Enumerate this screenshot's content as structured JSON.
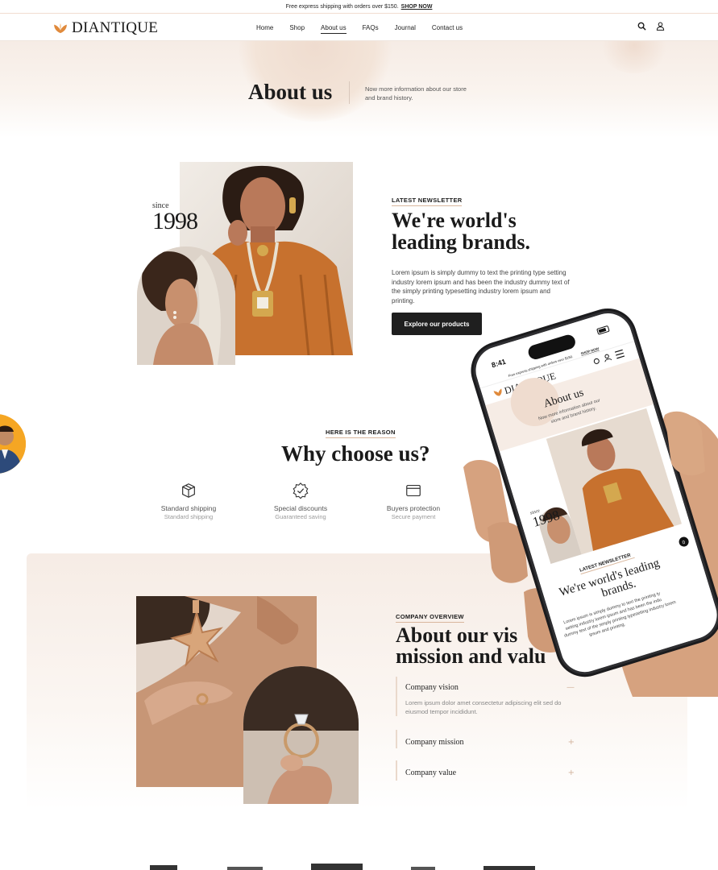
{
  "topbar": {
    "message": "Free express shipping with orders over $150.",
    "cta": "SHOP NOW"
  },
  "header": {
    "brand": "DIANTIQUE",
    "nav": [
      "Home",
      "Shop",
      "About us",
      "FAQs",
      "Journal",
      "Contact us"
    ],
    "active_nav": "About us",
    "icons": [
      "search-icon",
      "user-icon"
    ]
  },
  "hero": {
    "title": "About us",
    "description": "Now more information about our store and brand history."
  },
  "newsletter": {
    "since_label": "since",
    "since_year": "1998",
    "kicker": "LATEST NEWSLETTER",
    "title": "We're world's leading brands.",
    "body": "Lorem ipsum is simply dummy to text the printing type setting industry lorem ipsum and has been the industry dummy text of the simply printing typesetting industry lorem ipsum and printing.",
    "button": "Explore our products"
  },
  "why": {
    "kicker": "HERE IS THE REASON",
    "title": "Why choose us?",
    "features": [
      {
        "icon": "box-icon",
        "title": "Standard shipping",
        "sub": "Standard shipping"
      },
      {
        "icon": "badge-check-icon",
        "title": "Special discounts",
        "sub": "Guaranteed saving"
      },
      {
        "icon": "card-icon",
        "title": "Buyers protection",
        "sub": "Secure payment"
      }
    ]
  },
  "overview": {
    "kicker": "COMPANY OVERVIEW",
    "title_line1": "About our vis",
    "title_line2": "mission and valu",
    "accordion": [
      {
        "title": "Company vision",
        "toggle": "—",
        "body": "Lorem ipsum dolor amet consectetur adipiscing elit sed do eiusmod tempor incididunt.",
        "open": true
      },
      {
        "title": "Company mission",
        "toggle": "+",
        "open": false
      },
      {
        "title": "Company value",
        "toggle": "+",
        "open": false
      }
    ]
  },
  "phone": {
    "time": "8:41",
    "topbar": "Free express shipping with orders over $150.",
    "topbar_cta": "SHOP NOW",
    "brand": "DIANTIQUE",
    "hero_title": "About us",
    "hero_desc_line1": "Now more information about our",
    "hero_desc_line2": "store and brand history.",
    "since_label": "since",
    "since_year": "1998",
    "kicker": "LATEST NEWSLETTER",
    "title_line1": "We're world's leading",
    "title_line2": "brands.",
    "body_line1": "Lorem ipsum is simply dummy to text the printing ty",
    "body_line2": "setting industry lorem ipsum and has been the indu",
    "body_line3": "dummy text of the simply printing typesetting industry lorem",
    "body_line4": "ipsum and printing.",
    "cart_count": "0"
  },
  "colors": {
    "accent": "#e08a3c",
    "dark_button": "#1f1f1f",
    "hero_bg": "#f6ece5",
    "accent_line": "#d9b79d"
  }
}
